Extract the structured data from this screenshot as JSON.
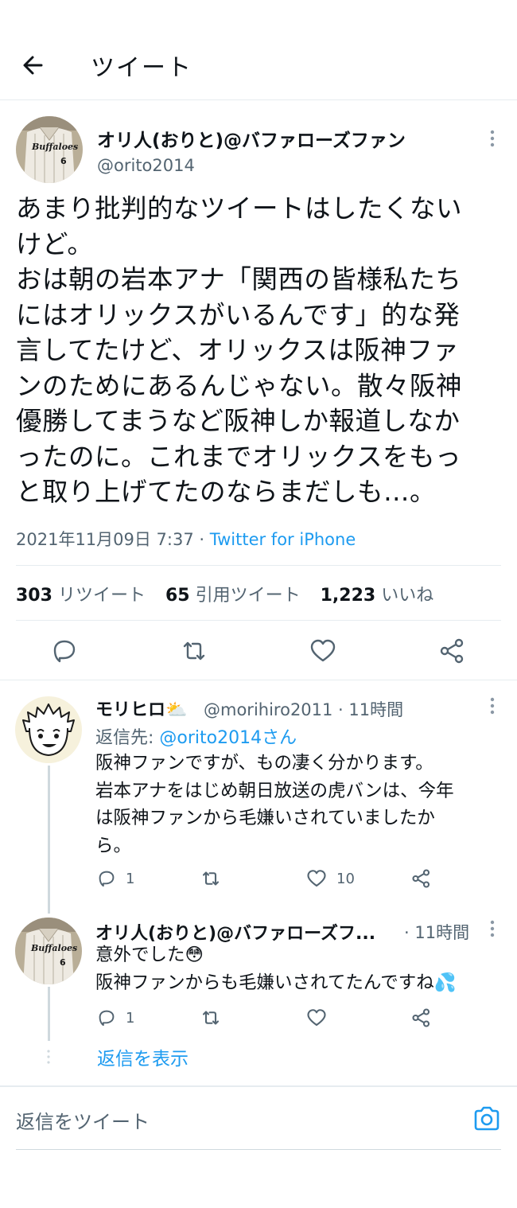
{
  "header": {
    "title": "ツイート",
    "back_icon": "arrow-left-icon"
  },
  "main_tweet": {
    "author_name": "オリ人(おりと)@バファローズファン",
    "handle": "@orito2014",
    "avatar_text": "Buffaloes",
    "avatar_number": "6",
    "lines": [
      "あまり批判的なツイートはしたくない",
      "けど。",
      "おは朝の岩本アナ「関西の皆様私たち",
      "にはオリックスがいるんです」的な発",
      "言してたけど、オリックスは阪神ファ",
      "ンのためにあるんじゃない。散々阪神",
      "優勝してまうなど阪神しか報道しなか",
      "ったのに。これまでオリックスをもっ",
      "と取り上げてたのならまだしも…。"
    ],
    "timestamp": "2021年11月09日 7:37 · ",
    "source": "Twitter for iPhone",
    "stats": {
      "retweets_count": "303",
      "retweets_label": "リツイート",
      "quotes_count": "65",
      "quotes_label": "引用ツイート",
      "likes_count": "1,223",
      "likes_label": "いいね"
    }
  },
  "replies": [
    {
      "author_name": "モリヒロ⛅",
      "meta": "@morihiro2011 · 11時間",
      "reply_to_prefix": "返信先: ",
      "reply_to_mention": "@orito2014さん",
      "lines": [
        "阪神ファンですが、もの凄く分かります。",
        "岩本アナをはじめ朝日放送の虎バンは、今年",
        "は阪神ファンから毛嫌いされていましたか",
        "ら。"
      ],
      "reply_count": "1",
      "retweet_count": "",
      "like_count": "10"
    },
    {
      "author_name": "オリ人(おりと)@バファローズフ...",
      "meta": "· 11時間",
      "lines": [
        "意外でした😳",
        "阪神ファンからも毛嫌いされてたんですね💦"
      ],
      "reply_count": "1",
      "retweet_count": "",
      "like_count": ""
    }
  ],
  "show_replies": "返信を表示",
  "compose": {
    "placeholder": "返信をツイート",
    "camera_icon": "camera-icon"
  },
  "colors": {
    "accent": "#1d9bf0",
    "text": "#0f1419",
    "secondary": "#536471",
    "border": "#e6ecf0"
  }
}
